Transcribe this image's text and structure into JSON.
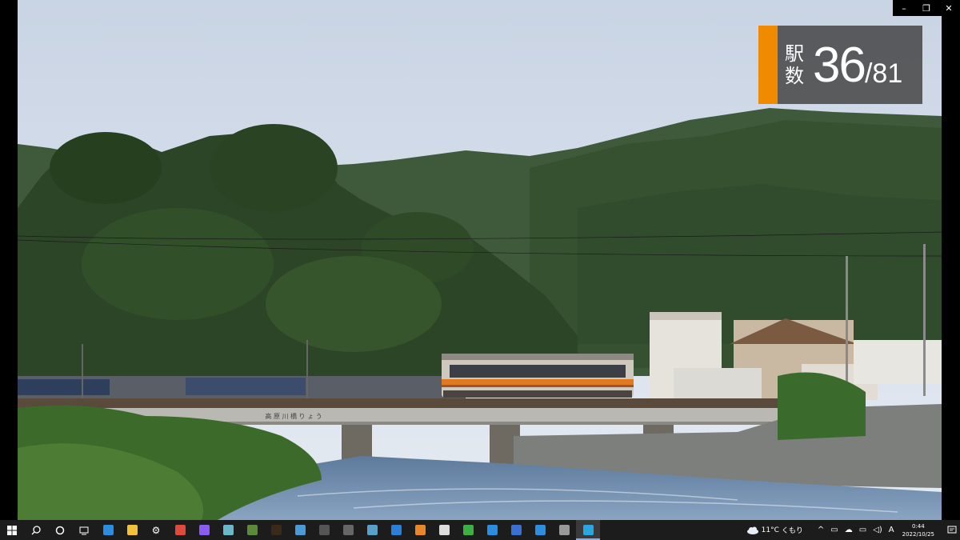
{
  "window": {
    "minimize_label": "–",
    "restore_label": "❐",
    "close_label": "✕"
  },
  "overlay": {
    "label": "駅数",
    "current": "36",
    "total": "/81",
    "accent_color": "#f08a00"
  },
  "video": {
    "bridge_sign": "高 原 川 橋 り ょ う"
  },
  "taskbar": {
    "pinned": [
      {
        "name": "start-button",
        "icon": "windows-icon"
      },
      {
        "name": "search-button",
        "icon": "search-icon"
      },
      {
        "name": "cortana-button",
        "icon": "cortana-icon"
      },
      {
        "name": "task-view-button",
        "icon": "task-view-icon"
      },
      {
        "name": "edge-app",
        "icon": "edge-icon",
        "color": "#2a8de0"
      },
      {
        "name": "explorer-app",
        "icon": "folder-icon",
        "color": "#f2c23a"
      },
      {
        "name": "settings-app",
        "icon": "gear-icon"
      },
      {
        "name": "chrome-app",
        "icon": "chrome-icon",
        "color": "#e04a3a"
      },
      {
        "name": "app-purple",
        "icon": "purple-app-icon",
        "color": "#8a5cf0"
      },
      {
        "name": "app-cube",
        "icon": "cube-icon",
        "color": "#6ab7c9"
      },
      {
        "name": "app-minecraft",
        "icon": "minecraft-icon",
        "color": "#5b8a3a"
      },
      {
        "name": "app-dark",
        "icon": "dark-app-icon",
        "color": "#3a2a1a"
      },
      {
        "name": "app-network",
        "icon": "network-icon",
        "color": "#4a9ad8"
      },
      {
        "name": "app-obs",
        "icon": "obs-icon",
        "color": "#555555"
      },
      {
        "name": "app-dots",
        "icon": "dots-icon",
        "color": "#666666"
      },
      {
        "name": "app-earth",
        "icon": "earth-icon",
        "color": "#58a0c8"
      },
      {
        "name": "app-mail",
        "icon": "mail-icon",
        "color": "#2b7fd4"
      },
      {
        "name": "app-blender",
        "icon": "blender-icon",
        "color": "#e8862a"
      },
      {
        "name": "app-notepad",
        "icon": "notepad-icon",
        "color": "#dddddd"
      },
      {
        "name": "app-shield",
        "icon": "shield-icon",
        "color": "#3cb043"
      },
      {
        "name": "app-store",
        "icon": "store-icon",
        "color": "#2a8de0"
      },
      {
        "name": "app-ocr",
        "icon": "ocr-icon",
        "color": "#3b6fd1"
      },
      {
        "name": "app-vscode",
        "icon": "vscode-icon",
        "color": "#2d8ee0"
      },
      {
        "name": "app-film",
        "icon": "film-icon",
        "color": "#999999"
      },
      {
        "name": "app-media-player",
        "icon": "play-icon",
        "color": "#2ca6e0",
        "active": true
      }
    ],
    "weather_temp": "11°C",
    "weather_text": "くもり",
    "ime_label": "A",
    "time": "0:44",
    "date": "2022/10/25"
  }
}
